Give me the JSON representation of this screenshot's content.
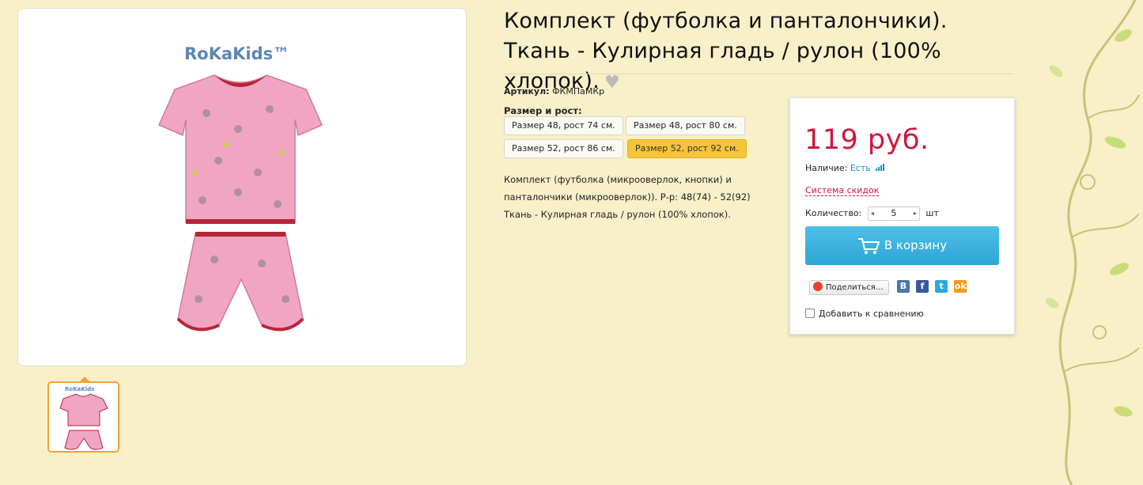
{
  "product": {
    "title": "Комплект (футболка и панталончики). Ткань - Кулирная гладь / рулон (100% хлопок).",
    "brand_logo_text": "RoKaKids™",
    "sku_label": "Артикул:",
    "sku_value": "ФКМПаМКр",
    "size_label": "Размер и рост:",
    "sizes": [
      {
        "label": "Размер 48, рост 74 см.",
        "selected": false
      },
      {
        "label": "Размер 48, рост 80 см.",
        "selected": false
      },
      {
        "label": "Размер 52, рост 86 см.",
        "selected": false
      },
      {
        "label": "Размер 52, рост 92 см.",
        "selected": true
      }
    ],
    "description": [
      "Комплект (футболка (микрооверлок, кнопки) и",
      "панталончики (микрооверлок)). Р-р: 48(74) - 52(92)",
      "Ткань - Кулирная гладь / рулон (100% хлопок)."
    ]
  },
  "buy": {
    "price": "119 руб.",
    "availability_label": "Наличие:",
    "availability_value": "Есть",
    "discount_link": "Система скидок",
    "quantity_label": "Количество:",
    "quantity_value": "5",
    "quantity_unit": "шт",
    "cart_button": "В корзину",
    "share_button": "Поделиться…",
    "social": [
      "В",
      "f",
      "t",
      "ok"
    ],
    "compare_label": "Добавить к сравнению",
    "compare_checked": false
  },
  "colors": {
    "price": "#d0173c",
    "cart_button": "#35aad9",
    "selected_size": "#f5c43a",
    "page_background": "#f8f0c9"
  }
}
